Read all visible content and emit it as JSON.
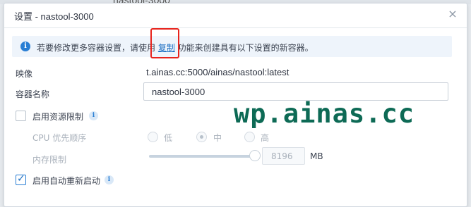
{
  "background": {
    "partial_text": "nastool-3000"
  },
  "dialog": {
    "title": "设置 - nastool-3000",
    "close_glyph": "×"
  },
  "info": {
    "icon": "i",
    "text_before": "若要修改更多容器设置，请使用 ",
    "link": "复制",
    "text_after": " 功能来创建具有以下设置的新容器。"
  },
  "fields": {
    "image_label": "映像",
    "image_value": "t.ainas.cc:5000/ainas/nastool:latest",
    "name_label": "容器名称",
    "name_value": "nastool-3000"
  },
  "resource_limit": {
    "label": "启用资源限制",
    "checked": false,
    "cpu_label": "CPU 优先顺序",
    "options": [
      "低",
      "中",
      "高"
    ],
    "selected": "中",
    "memory_label": "内存限制",
    "memory_value": "8196",
    "memory_unit": "MB",
    "memory_level": 1.0
  },
  "auto_restart": {
    "label": "启用自动重新启动",
    "checked": true,
    "tick": "✓"
  },
  "help_icon": "i",
  "watermark": "wp.ainas.cc",
  "colors": {
    "accent": "#1b6ec2",
    "highlight": "#e8231c",
    "watermark": "#0d6a55"
  }
}
